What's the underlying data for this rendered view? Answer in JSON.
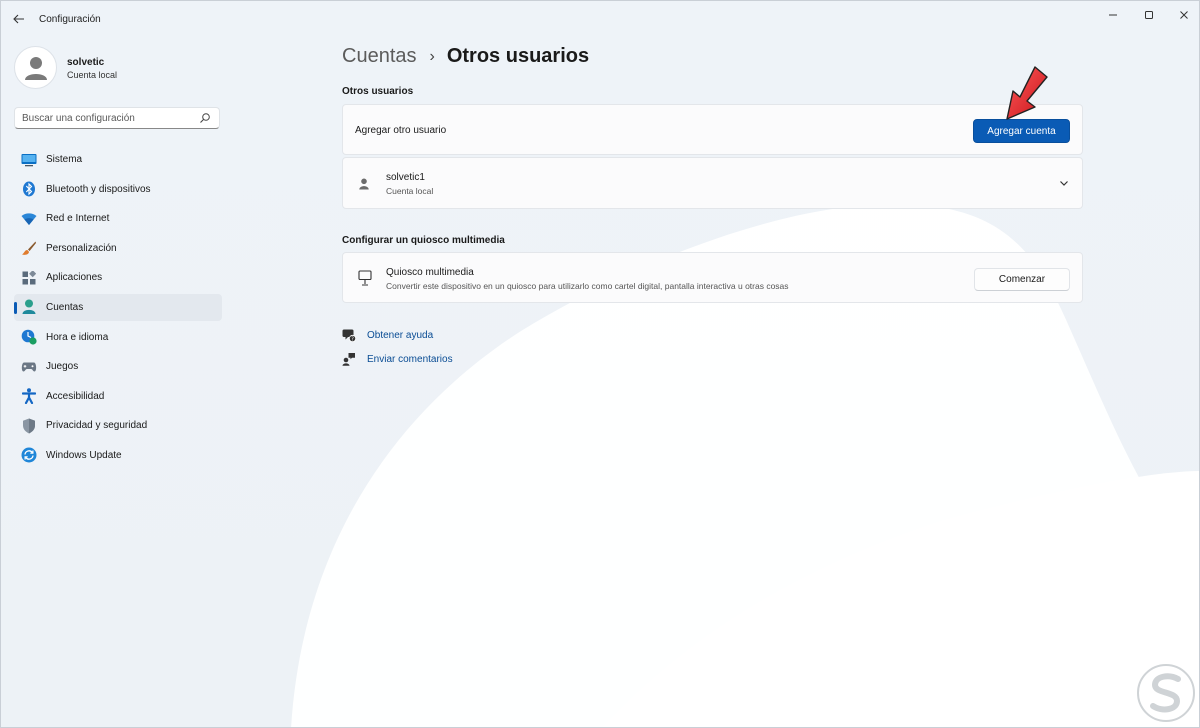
{
  "app": {
    "title": "Configuración"
  },
  "window_controls": {
    "minimize": "—",
    "maximize": "☐",
    "close": "✕"
  },
  "profile": {
    "name": "solvetic",
    "type": "Cuenta local"
  },
  "search": {
    "placeholder": "Buscar una configuración"
  },
  "nav": {
    "items": [
      {
        "label": "Sistema",
        "icon": "monitor-icon",
        "color": "#0a6fc4"
      },
      {
        "label": "Bluetooth y dispositivos",
        "icon": "bluetooth-icon",
        "color": "#1e78d2"
      },
      {
        "label": "Red e Internet",
        "icon": "wifi-icon",
        "color": "#2b87d8"
      },
      {
        "label": "Personalización",
        "icon": "brush-icon",
        "color": "#e07c2e"
      },
      {
        "label": "Aplicaciones",
        "icon": "apps-icon",
        "color": "#5a6b7c"
      },
      {
        "label": "Cuentas",
        "icon": "person-icon",
        "color": "#2b9f8c",
        "active": true
      },
      {
        "label": "Hora e idioma",
        "icon": "clock-globe-icon",
        "color": "#1e78d2"
      },
      {
        "label": "Juegos",
        "icon": "gamepad-icon",
        "color": "#6b7785"
      },
      {
        "label": "Accesibilidad",
        "icon": "accessibility-icon",
        "color": "#1467c4"
      },
      {
        "label": "Privacidad y seguridad",
        "icon": "shield-icon",
        "color": "#8a96a3"
      },
      {
        "label": "Windows Update",
        "icon": "update-icon",
        "color": "#1f86d8"
      }
    ]
  },
  "breadcrumb": {
    "parent": "Cuentas",
    "separator": "›",
    "current": "Otros usuarios"
  },
  "other_users": {
    "section_title": "Otros usuarios",
    "add_label": "Agregar otro usuario",
    "add_button": "Agregar cuenta",
    "user": {
      "name": "solvetic1",
      "type": "Cuenta local"
    }
  },
  "kiosk": {
    "section_title": "Configurar un quiosco multimedia",
    "title": "Quiosco multimedia",
    "description": "Convertir este dispositivo en un quiosco para utilizarlo como cartel digital, pantalla interactiva u otras cosas",
    "button": "Comenzar"
  },
  "links": {
    "help": "Obtener ayuda",
    "feedback": "Enviar comentarios"
  },
  "colors": {
    "accent": "#0a5bb5",
    "link": "#0a4c94",
    "annotation_arrow": "#e8262b"
  }
}
